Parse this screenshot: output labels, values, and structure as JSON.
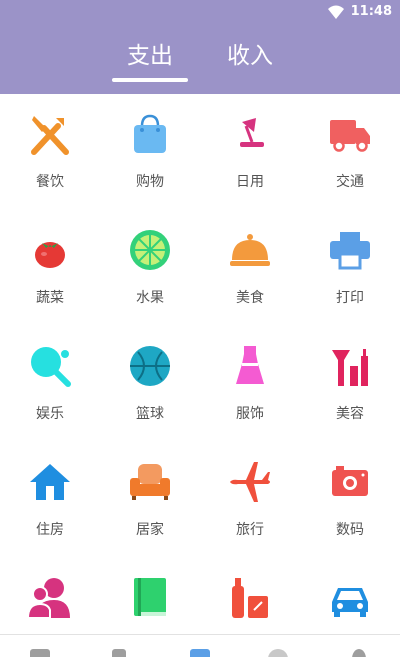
{
  "status_bar": {
    "time": "11:48"
  },
  "tabs": [
    {
      "label": "支出",
      "active": true
    },
    {
      "label": "收入",
      "active": false
    }
  ],
  "categories": [
    {
      "label": "餐饮",
      "icon": "fork-knife-icon",
      "color": "#f0922b"
    },
    {
      "label": "购物",
      "icon": "shopping-bag-icon",
      "color": "#6ab9f2"
    },
    {
      "label": "日用",
      "icon": "desk-lamp-icon",
      "color": "#d6337f"
    },
    {
      "label": "交通",
      "icon": "truck-icon",
      "color": "#f06060"
    },
    {
      "label": "蔬菜",
      "icon": "tomato-icon",
      "color": "#e53935"
    },
    {
      "label": "水果",
      "icon": "lime-icon",
      "color": "#33d17a"
    },
    {
      "label": "美食",
      "icon": "food-cloche-icon",
      "color": "#f39a3d"
    },
    {
      "label": "打印",
      "icon": "printer-icon",
      "color": "#5b9fe6"
    },
    {
      "label": "娱乐",
      "icon": "ping-pong-icon",
      "color": "#26e0e0"
    },
    {
      "label": "篮球",
      "icon": "basketball-icon",
      "color": "#1ea7c4"
    },
    {
      "label": "服饰",
      "icon": "dress-icon",
      "color": "#f45bd2"
    },
    {
      "label": "美容",
      "icon": "makeup-icon",
      "color": "#e0245e"
    },
    {
      "label": "住房",
      "icon": "house-icon",
      "color": "#1f8ee0"
    },
    {
      "label": "居家",
      "icon": "sofa-icon",
      "color": "#f07a2b"
    },
    {
      "label": "旅行",
      "icon": "airplane-icon",
      "color": "#f0503c"
    },
    {
      "label": "数码",
      "icon": "camera-icon",
      "color": "#ef5350"
    },
    {
      "label": "",
      "icon": "users-icon",
      "color": "#d6337f"
    },
    {
      "label": "",
      "icon": "book-icon",
      "color": "#2ed16e"
    },
    {
      "label": "",
      "icon": "bottles-icon",
      "color": "#f0503c"
    },
    {
      "label": "",
      "icon": "car-icon",
      "color": "#1f8ee0"
    }
  ],
  "bottom_nav": [
    {
      "icon": "ledger-icon",
      "color": "#9e9e9e"
    },
    {
      "icon": "chart-icon",
      "color": "#9e9e9e"
    },
    {
      "icon": "grid-icon",
      "color": "#5b9fe6"
    },
    {
      "icon": "discount-icon",
      "color": "#c8c8c8"
    },
    {
      "icon": "profile-icon",
      "color": "#9e9e9e"
    }
  ],
  "colors": {
    "header": "#9b93c8",
    "label": "#555555"
  }
}
